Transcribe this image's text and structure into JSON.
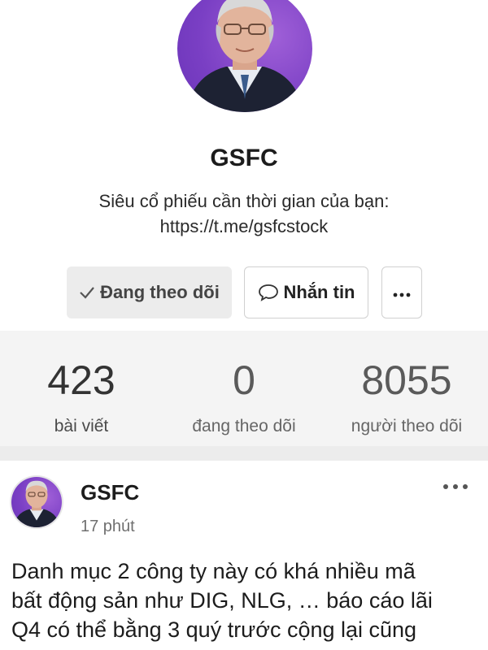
{
  "profile": {
    "name": "GSFC",
    "bio_line1": "Siêu cổ phiếu cần thời gian của bạn:",
    "bio_line2": "https://t.me/gsfcstock",
    "avatar_icon": "profile-photo"
  },
  "actions": {
    "following_label": "Đang theo dõi",
    "message_label": "Nhắn tin",
    "more_icon": "more-horizontal-icon"
  },
  "stats": [
    {
      "value": "423",
      "label": "bài viết"
    },
    {
      "value": "0",
      "label": "đang theo dõi"
    },
    {
      "value": "8055",
      "label": "người theo dõi"
    }
  ],
  "post": {
    "author": "GSFC",
    "time": "17 phút",
    "text_line1": "Danh mục 2 công ty này có khá nhiều mã",
    "text_line2": "bất động sản như DIG, NLG, … báo cáo lãi",
    "text_line3": "Q4 có thể bằng 3 quý trước cộng lại cũng"
  },
  "colors": {
    "avatar_bg": "#7a3fc4",
    "stats_bg": "#f4f4f4",
    "following_bg": "#ececec"
  }
}
